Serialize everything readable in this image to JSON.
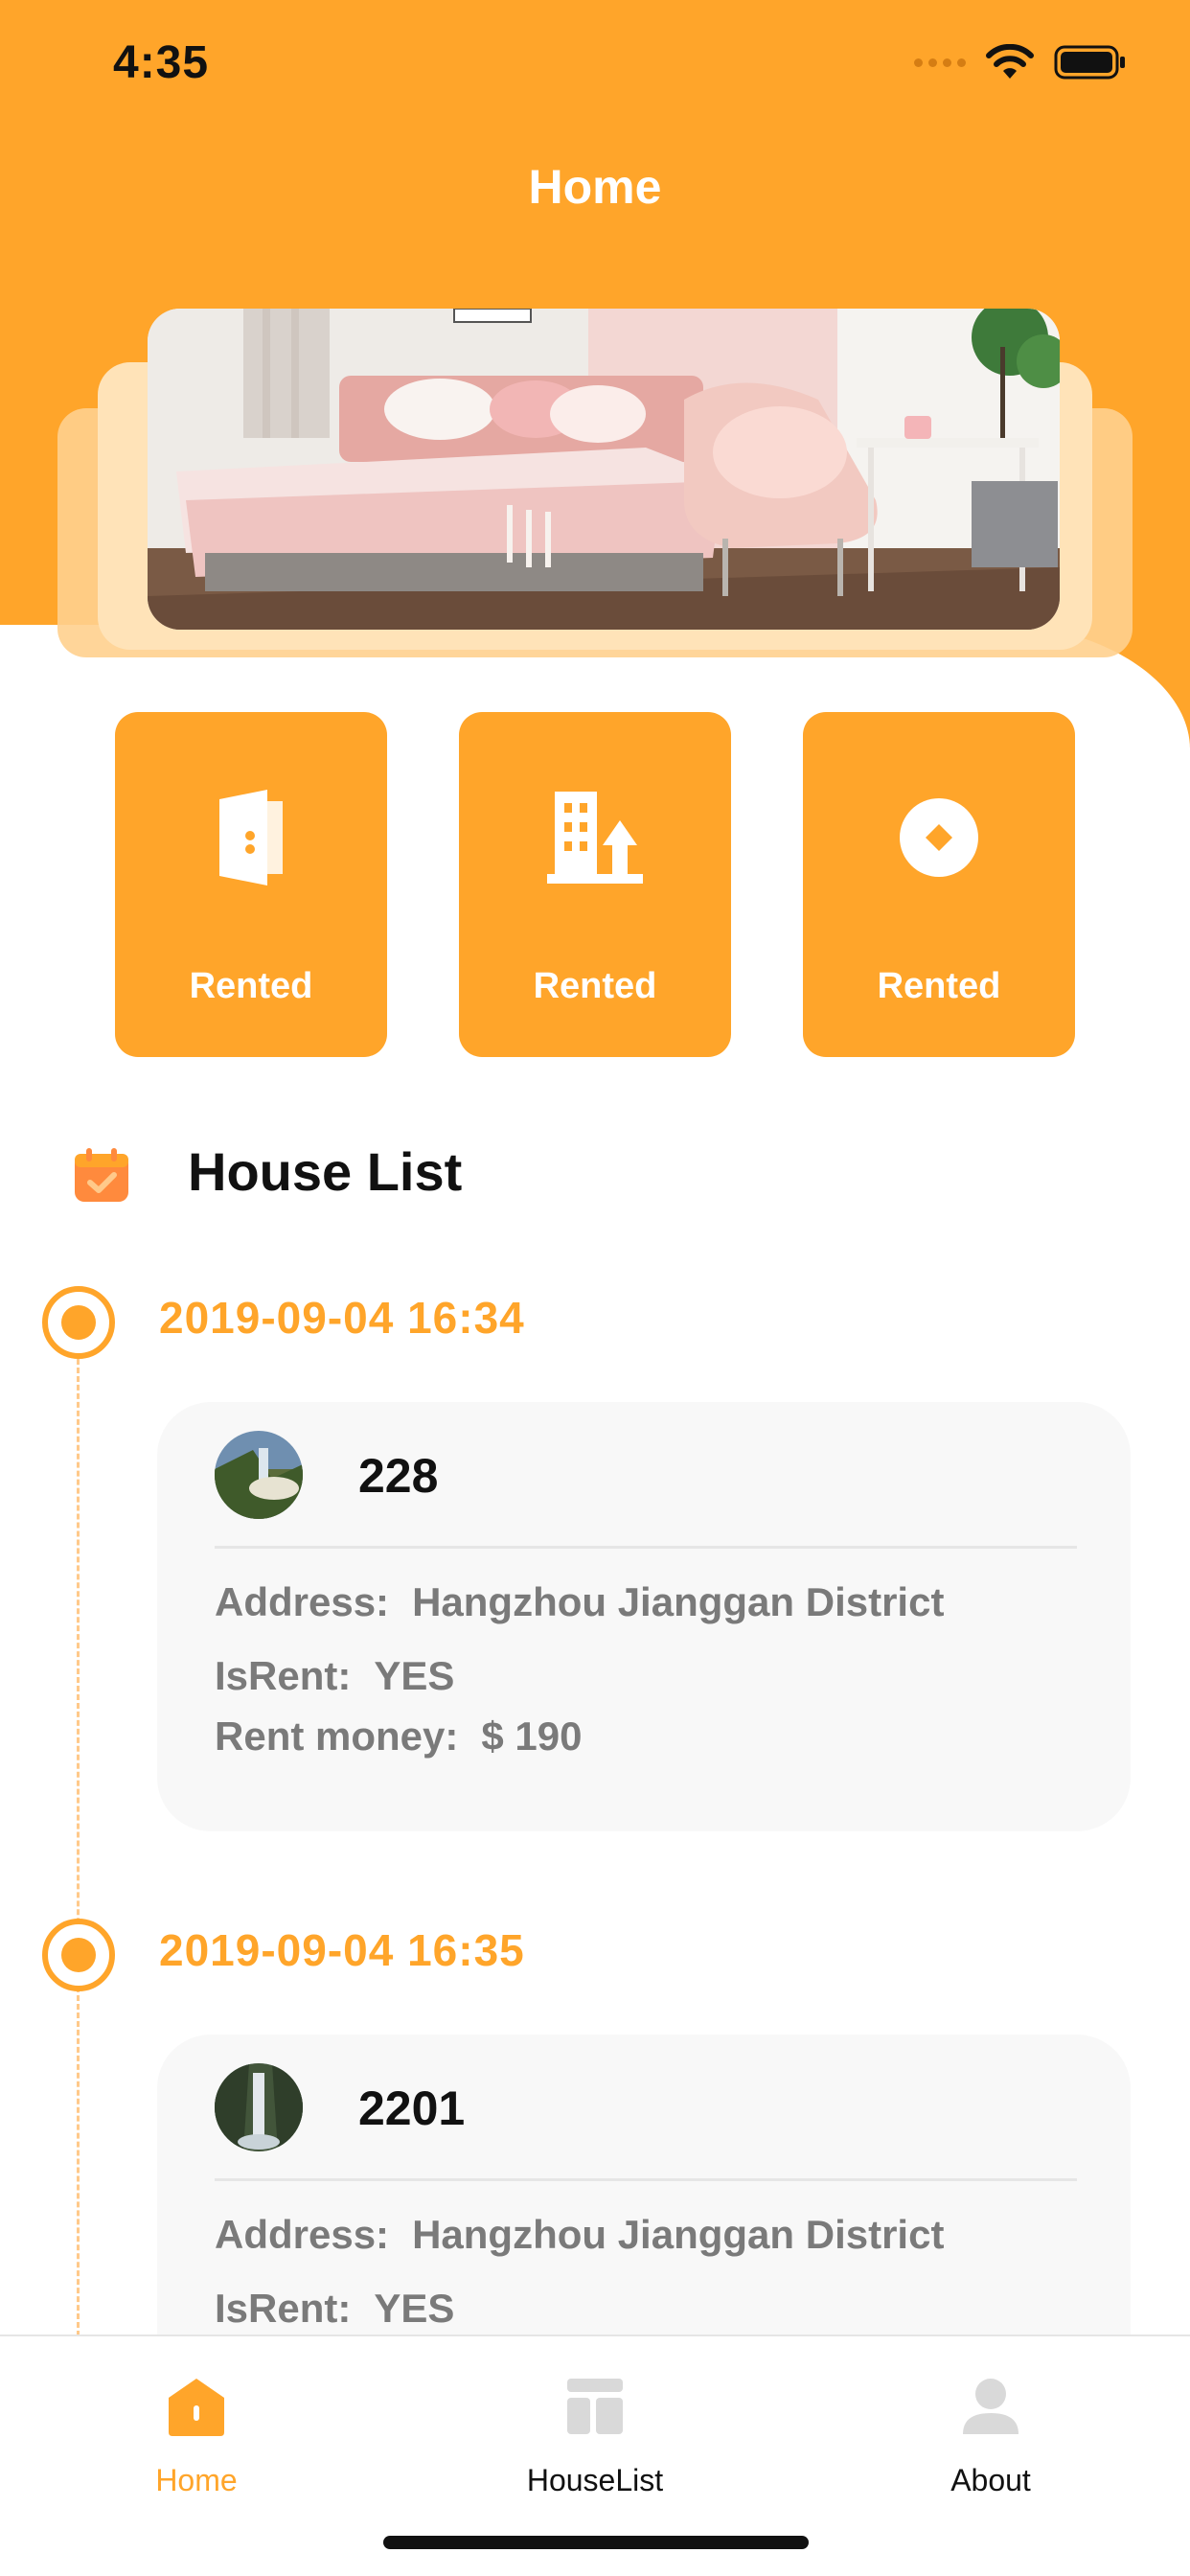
{
  "status_bar": {
    "time": "4:35"
  },
  "nav": {
    "title": "Home"
  },
  "theme": {
    "accent": "#FFA52A",
    "muted_text": "#7A7A7A",
    "card_bg": "#F8F8F8"
  },
  "tiles": [
    {
      "label": "Rented",
      "icon": "door-icon"
    },
    {
      "label": "Rented",
      "icon": "building-icon"
    },
    {
      "label": "Rented",
      "icon": "coin-icon"
    }
  ],
  "section": {
    "title": "House List",
    "icon": "calendar-check-icon"
  },
  "houses": [
    {
      "date": "2019-09-04 16:34",
      "name": "228",
      "address_label": "Address:",
      "address": "Hangzhou Jianggan District",
      "isrent_label": "IsRent:",
      "isrent": "YES",
      "rent_label": "Rent money:",
      "rent": "$ 190"
    },
    {
      "date": "2019-09-04 16:35",
      "name": "2201",
      "address_label": "Address:",
      "address": "Hangzhou Jianggan District",
      "isrent_label": "IsRent:",
      "isrent": "YES"
    }
  ],
  "tabbar": {
    "items": [
      {
        "label": "Home",
        "icon": "home-icon",
        "active": true
      },
      {
        "label": "HouseList",
        "icon": "list-layout-icon",
        "active": false
      },
      {
        "label": "About",
        "icon": "person-icon",
        "active": false
      }
    ]
  }
}
